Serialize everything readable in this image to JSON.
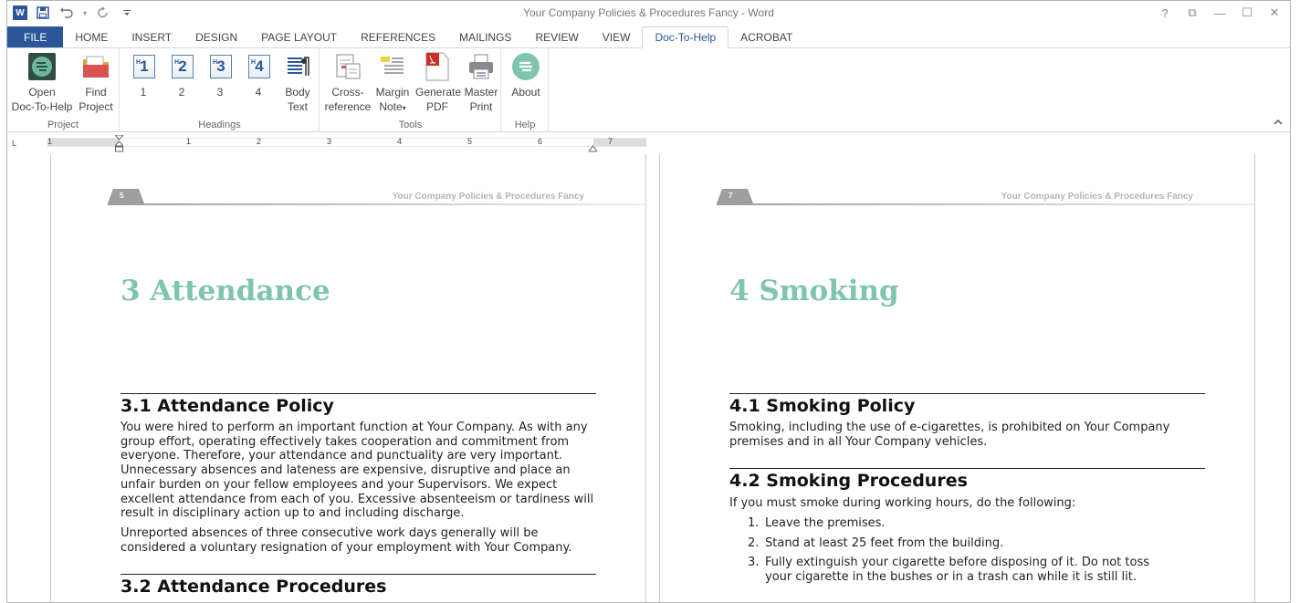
{
  "window": {
    "title": "Your Company Policies & Procedures Fancy - Word",
    "controls": [
      "?",
      "⧉",
      "—",
      "☐",
      "✕"
    ]
  },
  "qat": {
    "app_icon": "W",
    "save": "💾",
    "undo": "↶",
    "redo": "↻",
    "customize": "⌄"
  },
  "tabs": [
    {
      "label": "FILE"
    },
    {
      "label": "HOME"
    },
    {
      "label": "INSERT"
    },
    {
      "label": "DESIGN"
    },
    {
      "label": "PAGE LAYOUT"
    },
    {
      "label": "REFERENCES"
    },
    {
      "label": "MAILINGS"
    },
    {
      "label": "REVIEW"
    },
    {
      "label": "VIEW"
    },
    {
      "label": "Doc-To-Help"
    },
    {
      "label": "ACROBAT"
    }
  ],
  "ribbon": {
    "groups": {
      "project": "Project",
      "headings": "Headings",
      "tools": "Tools",
      "help": "Help"
    },
    "buttons": {
      "open_line1": "Open",
      "open_line2": "Doc-To-Help",
      "find_line1": "Find",
      "find_line2": "Project",
      "h1": "1",
      "h2": "2",
      "h3": "3",
      "h4": "4",
      "body_line1": "Body",
      "body_line2": "Text",
      "cross_line1": "Cross-",
      "cross_line2": "reference",
      "margin_line1": "Margin",
      "margin_line2": "Note",
      "gen_line1": "Generate",
      "gen_line2": "PDF",
      "master_line1": "Master",
      "master_line2": "Print",
      "about": "About"
    },
    "heading_icons": [
      "1",
      "2",
      "3",
      "4"
    ],
    "heading_icon_prefix": "H"
  },
  "ruler": {
    "corner": "L",
    "numbers": [
      "1",
      "1",
      "2",
      "3",
      "4",
      "5",
      "6",
      "7"
    ]
  },
  "pages": {
    "left": {
      "page_number": "5",
      "header_text": "Your Company Policies & Procedures Fancy",
      "chapter": "3 Attendance",
      "section1_title": "3.1 Attendance Policy",
      "section1_para1": "You were hired to perform an important function at Your Company. As with any group effort, operating effectively takes cooperation and commitment from everyone. Therefore, your attendance and punctuality are very important. Unnecessary absences and lateness are expensive, disruptive and place an unfair burden on your fellow employees and your Supervisors. We expect excellent attendance from each of you. Excessive absenteeism or tardiness will result in disciplinary action up to and including discharge.",
      "section1_para2": "Unreported absences of three consecutive work days generally will be considered a voluntary resignation of your employment with Your Company.",
      "section2_title": "3.2 Attendance Procedures"
    },
    "right": {
      "page_number": "7",
      "header_text": "Your Company Policies & Procedures Fancy",
      "chapter": "4 Smoking",
      "section1_title": "4.1 Smoking Policy",
      "section1_para": "Smoking, including the use of e-cigarettes, is prohibited on Your Company premises and in all Your Company vehicles.",
      "section2_title": "4.2 Smoking Procedures",
      "section2_intro": "If you must smoke during working hours, do the following:",
      "steps": [
        {
          "n": "1.",
          "text": "Leave the premises."
        },
        {
          "n": "2.",
          "text": "Stand at least 25 feet from the building."
        },
        {
          "n": "3.",
          "text": "Fully extinguish your cigarette before disposing of it. Do not toss your cigarette in the bushes or in a trash can while it is still lit."
        }
      ]
    }
  },
  "colors": {
    "brand": "#2b579a",
    "chapter": "#7fc4ad"
  }
}
